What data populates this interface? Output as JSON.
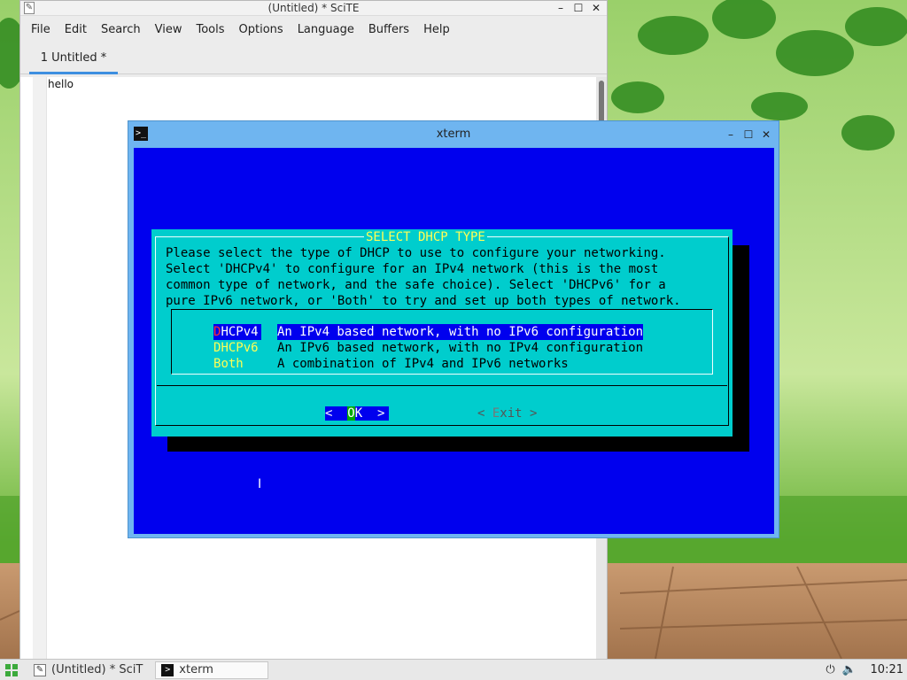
{
  "scite": {
    "title": "(Untitled) * SciTE",
    "menu": [
      "File",
      "Edit",
      "Search",
      "View",
      "Tools",
      "Options",
      "Language",
      "Buffers",
      "Help"
    ],
    "tab_label": "1 Untitled *",
    "editor_text": "hello"
  },
  "xterm": {
    "title": "xterm",
    "dialog": {
      "title": "SELECT DHCP TYPE",
      "description": [
        "Please select the type of DHCP to use to configure your networking.",
        "Select 'DHCPv4' to configure for an IPv4 network (this is the most",
        "common type of network, and the safe choice). Select 'DHCPv6' for a",
        "pure IPv6 network, or 'Both' to try and set up both types of network."
      ],
      "items": [
        {
          "hot": "D",
          "rest": "HCPv4",
          "text": "An IPv4 based network, with no IPv6 configuration",
          "selected": true
        },
        {
          "hot": "D",
          "rest": "HCPv6",
          "text": "An IPv6 based network, with no IPv4 configuration",
          "selected": false
        },
        {
          "hot": "B",
          "rest": "oth",
          "text": "A combination of IPv4 and IPv6 networks",
          "selected": false
        }
      ],
      "ok_pre": "<  ",
      "ok_hot": "O",
      "ok_post": "K  >",
      "exit_pre": "< ",
      "exit_hot": "E",
      "exit_post": "xit >"
    }
  },
  "taskbar": {
    "tasks": [
      {
        "label": "(Untitled) * SciT",
        "icon": "scite-icon",
        "active": false
      },
      {
        "label": "xterm",
        "icon": "terminal-icon",
        "active": true
      }
    ],
    "clock": "10:21"
  },
  "colors": {
    "terminal_bg": "#0000ee",
    "dialog_bg": "#00cdcd",
    "dialog_title": "#ffff55",
    "xterm_frame": "#6fb5f0"
  }
}
